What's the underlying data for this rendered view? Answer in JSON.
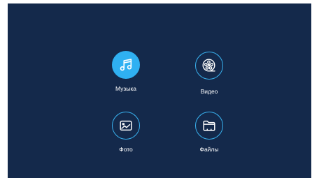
{
  "menu": {
    "items": [
      {
        "label": "Музыка",
        "icon": "music-icon",
        "selected": true
      },
      {
        "label": "Видео",
        "icon": "film-reel-icon",
        "selected": false
      },
      {
        "label": "Фото",
        "icon": "photo-icon",
        "selected": false
      },
      {
        "label": "Файлы",
        "icon": "folder-icon",
        "selected": false
      }
    ]
  },
  "colors": {
    "background": "#14294b",
    "accent": "#2fb0f2",
    "label": "#ffffff"
  }
}
